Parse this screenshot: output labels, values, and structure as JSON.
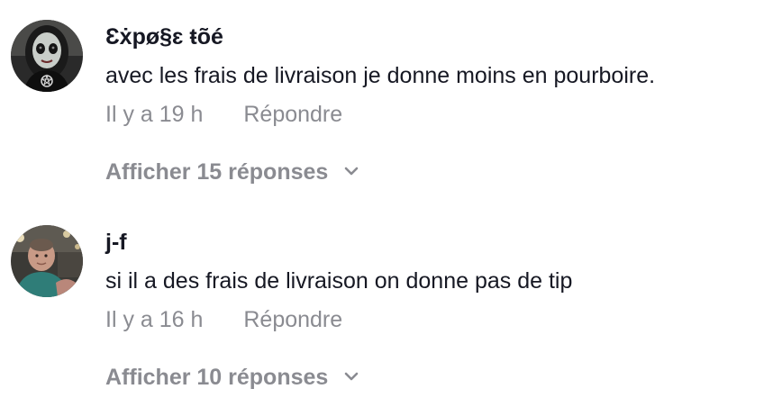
{
  "comments": [
    {
      "username": "Ɛẋpø§ɛ ŧõé",
      "text": "avec les frais de livraison je donne moins en pourboire.",
      "time": "Il y a 19 h",
      "reply_label": "Répondre",
      "view_replies_label": "Afficher 15 réponses",
      "avatar_icon": "gothic-doll-avatar"
    },
    {
      "username": "j-f",
      "text": "si il a des frais de livraison on donne pas de tip",
      "time": "Il y a 16 h",
      "reply_label": "Répondre",
      "view_replies_label": "Afficher 10 réponses",
      "avatar_icon": "man-photo-avatar"
    }
  ],
  "colors": {
    "primary_text": "#161823",
    "secondary_text": "#8a8b91",
    "background": "#ffffff"
  }
}
